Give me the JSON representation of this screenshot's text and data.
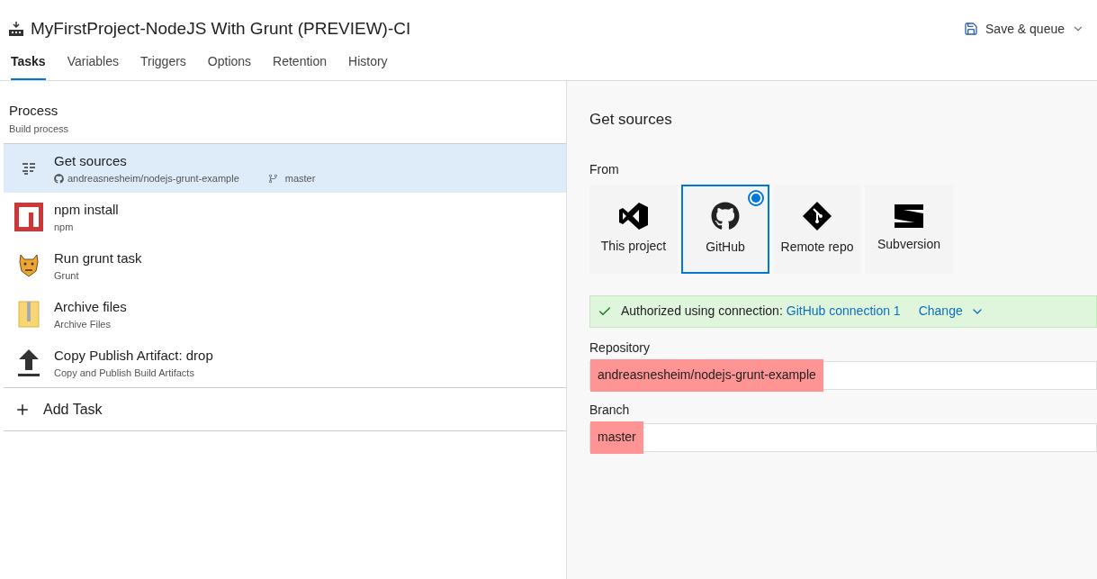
{
  "header": {
    "title": "MyFirstProject-NodeJS With Grunt (PREVIEW)-CI",
    "save_button": "Save & queue"
  },
  "tabs": [
    {
      "label": "Tasks",
      "selected": true
    },
    {
      "label": "Variables",
      "selected": false
    },
    {
      "label": "Triggers",
      "selected": false
    },
    {
      "label": "Options",
      "selected": false
    },
    {
      "label": "Retention",
      "selected": false
    },
    {
      "label": "History",
      "selected": false
    }
  ],
  "process": {
    "title": "Process",
    "subtitle": "Build process"
  },
  "tasks": [
    {
      "kind": "sources",
      "name": "Get sources",
      "repo": "andreasnesheim/nodejs-grunt-example",
      "branch": "master",
      "selected": true
    },
    {
      "kind": "npm",
      "name": "npm install",
      "subtitle": "npm",
      "selected": false
    },
    {
      "kind": "grunt",
      "name": "Run grunt task",
      "subtitle": "Grunt",
      "selected": false
    },
    {
      "kind": "archive",
      "name": "Archive files",
      "subtitle": "Archive Files",
      "selected": false
    },
    {
      "kind": "upload",
      "name": "Copy Publish Artifact: drop",
      "subtitle": "Copy and Publish Build Artifacts",
      "selected": false
    }
  ],
  "add_task": "Add Task",
  "details": {
    "title": "Get sources",
    "from_label": "From",
    "sources": [
      {
        "kind": "vs",
        "label": "This project",
        "selected": false
      },
      {
        "kind": "github",
        "label": "GitHub",
        "selected": true
      },
      {
        "kind": "git",
        "label": "Remote repo",
        "selected": false
      },
      {
        "kind": "svn",
        "label": "Subversion",
        "selected": false
      }
    ],
    "auth": {
      "text": "Authorized using connection:",
      "connection": "GitHub connection 1",
      "change": "Change"
    },
    "fields": [
      {
        "label": "Repository",
        "value": "andreasnesheim/nodejs-grunt-example",
        "highlighted": true
      },
      {
        "label": "Branch",
        "value": "master",
        "highlighted": true
      }
    ]
  }
}
